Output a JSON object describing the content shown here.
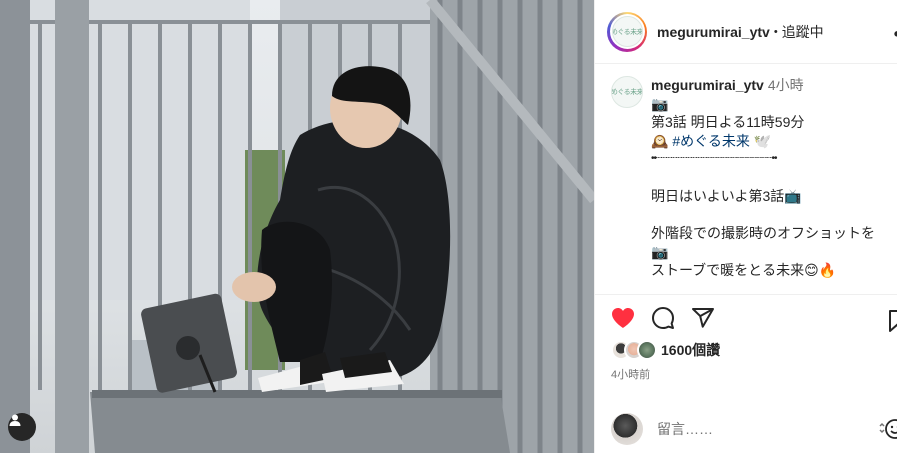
{
  "colors": {
    "like_red": "#ff3040",
    "hashtag": "#00376b",
    "secondary_text": "#737373",
    "primary_text": "#262626"
  },
  "header": {
    "username": "megurumirai_ytv",
    "separator": "•",
    "follow_status": "追蹤中",
    "more_icon": "more-horizontal-icon",
    "avatar_logo_text": "めぐる未来"
  },
  "caption": {
    "username": "megurumirai_ytv",
    "time": "4小時",
    "line_camera": "📷",
    "line_episode": "第3話 明日よる11時59分",
    "line_hashtag_prefix": "🕰️",
    "hashtag": "#めぐる未来",
    "line_hashtag_suffix": "🕊️",
    "divider": "••┈┈┈┈┈┈┈┈┈┈┈┈┈┈┈┈┈┈┈┈┈┈┈••",
    "line_tomorrow": "明日はいよいよ第3話",
    "line_tomorrow_emoji": "📺",
    "line_offshot": "外階段での撮影時のオフショットを",
    "line_camera2": "📷",
    "line_stove": "ストーブで暖をとる未来",
    "line_stove_emoji": "😊🔥"
  },
  "actions": {
    "like_icon": "heart-filled-icon",
    "comment_icon": "comment-icon",
    "share_icon": "share-icon",
    "save_icon": "bookmark-icon",
    "likes_count": "1600個讚",
    "post_time": "4小時前"
  },
  "comment": {
    "placeholder": "留言……",
    "emoji_icon": "emoji-icon"
  }
}
